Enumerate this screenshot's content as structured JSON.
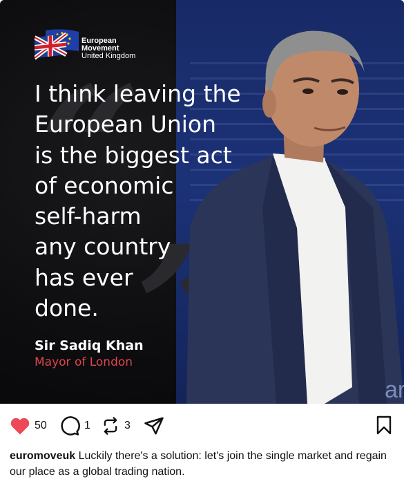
{
  "post": {
    "logo": {
      "line1": "European",
      "line2": "Movement",
      "line3": "United Kingdom",
      "icon": "uk-flag-with-eu-stars"
    },
    "quote_lines": [
      "I think leaving the",
      "European Union",
      "is the biggest act",
      "of economic",
      "self-harm",
      "any country",
      "has ever",
      "done."
    ],
    "attribution": {
      "name": "Sir Sadiq Khan",
      "role": "Mayor of London"
    },
    "corner_text": "ar",
    "colors": {
      "accent_red": "#e0454b",
      "like_red": "#ed4956",
      "backdrop_blue": "#1c3277"
    }
  },
  "actions": {
    "likes": "50",
    "comments": "1",
    "reposts": "3"
  },
  "caption": {
    "username": "euromoveuk",
    "text": "Luckily there's a solution: let's join the single market and regain our place as a global trading nation."
  }
}
